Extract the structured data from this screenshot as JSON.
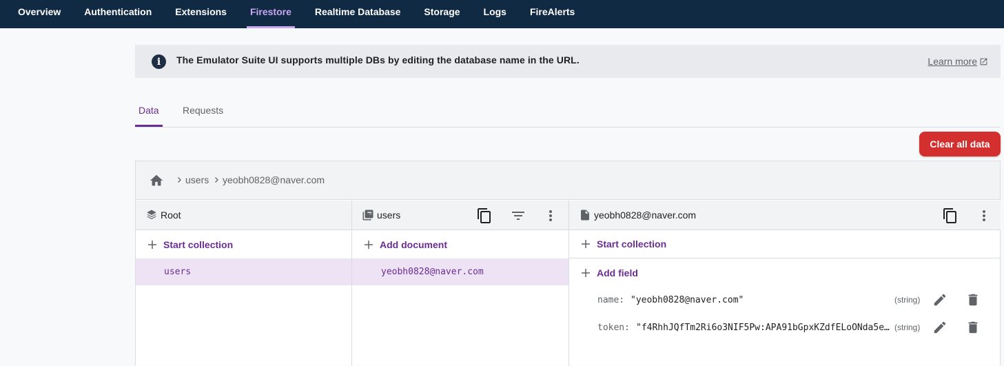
{
  "nav": {
    "tabs": [
      {
        "label": "Overview"
      },
      {
        "label": "Authentication"
      },
      {
        "label": "Extensions"
      },
      {
        "label": "Firestore"
      },
      {
        "label": "Realtime Database"
      },
      {
        "label": "Storage"
      },
      {
        "label": "Logs"
      },
      {
        "label": "FireAlerts"
      }
    ],
    "active": "Firestore",
    "active_color": "#c7a6f2",
    "background": "#102a43"
  },
  "banner": {
    "text": "The Emulator Suite UI supports multiple DBs by editing the database name in the URL.",
    "link": "Learn more",
    "icon": "info-icon"
  },
  "subtabs": {
    "items": [
      {
        "label": "Data"
      },
      {
        "label": "Requests"
      }
    ],
    "active": "Data"
  },
  "actions": {
    "clear_label": "Clear all data",
    "clear_color": "#d32f2f"
  },
  "breadcrumb": {
    "items": [
      "users",
      "yeobh0828@naver.com"
    ]
  },
  "columns": {
    "root": {
      "title": "Root",
      "action": "Start collection",
      "items": [
        "users"
      ]
    },
    "collection": {
      "title": "users",
      "action": "Add document",
      "items": [
        "yeobh0828@naver.com"
      ]
    },
    "document": {
      "title": "yeobh0828@naver.com",
      "action_collection": "Start collection",
      "action_field": "Add field",
      "fields": [
        {
          "key": "name:",
          "value": "\"yeobh0828@naver.com\"",
          "type": "(string)"
        },
        {
          "key": "token:",
          "value": "\"f4RhhJQfTm2Ri6o3NIF5Pw:APA91bGpxKZdfELoONda5e…",
          "type": "(string)"
        }
      ]
    }
  },
  "accent": "#6a2d91"
}
